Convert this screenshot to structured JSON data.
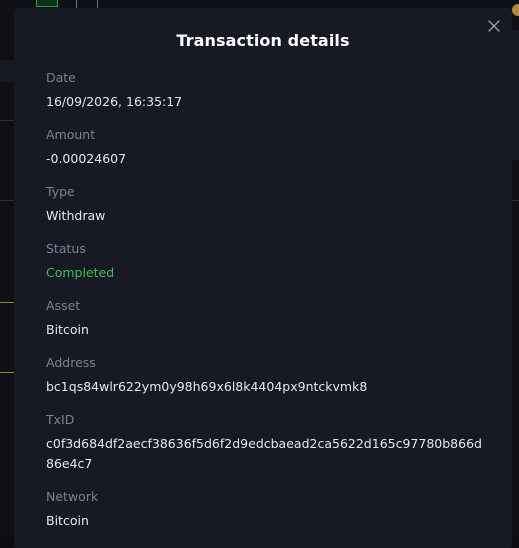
{
  "modal": {
    "title": "Transaction details",
    "fields": [
      {
        "label": "Date",
        "value": "16/09/2026, 16:35:17"
      },
      {
        "label": "Amount",
        "value": "-0.00024607"
      },
      {
        "label": "Type",
        "value": "Withdraw"
      },
      {
        "label": "Status",
        "value": "Completed"
      },
      {
        "label": "Asset",
        "value": "Bitcoin"
      },
      {
        "label": "Address",
        "value": "bc1qs84wlr622ym0y98h69x6l8k4404px9ntckvmk8"
      },
      {
        "label": "TxID",
        "value": "c0f3d684df2aecf38636f5d6f2d9edcbaead2ca5622d165c97780b866d86e4c7"
      },
      {
        "label": "Network",
        "value": "Bitcoin"
      }
    ]
  },
  "icons": {
    "close": "close-icon"
  },
  "colors": {
    "status_completed": "#3fbf4f",
    "modal_background": "#171a25",
    "label": "#7d8291",
    "value": "#e6e8ee"
  }
}
